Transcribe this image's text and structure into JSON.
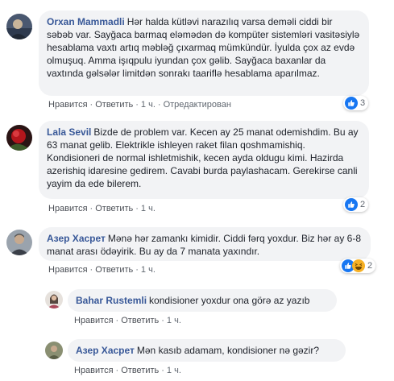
{
  "comments": [
    {
      "author": "Orxan Mammadli",
      "text": "Hər halda kütləvi narazılıq varsa deməli ciddi bir səbəb var. Sayğaca barmaq eləmədən də kompüter sistemləri vasitəsiylə hesablama vaxtı artıq məbləğ çıxarmaq mümkündür. İyulda çox az evdə olmuşuq. Amma işıqpulu iyundan çox gəlib. Sayğaca baxanlar da vaxtında gəlsələr limitdən sonrakı taariflə hesablama aparılmaz.",
      "like": "Нравится",
      "reply": "Ответить",
      "time": "1 ч.",
      "edited": "Отредактирован",
      "reactions": "3"
    },
    {
      "author": "Lala Sevil",
      "text": "Bizde de problem var. Kecen ay 25 manat odemishdim. Bu ay 63 manat gelib. Elektrikle ishleyen raket filan qoshmamishiq. Kondisioneri de normal ishletmishik, kecen ayda oldugu kimi. Hazirda azerishiq idaresine gedirem. Cavabi burda paylashacam. Gerekirse canli yayim da ede bilerem.",
      "like": "Нравится",
      "reply": "Ответить",
      "time": "1 ч.",
      "reactions": "2"
    },
    {
      "author": "Азер Хасрет",
      "text": "Mənə hər zamankı kimidir. Ciddi fərq yoxdur. Biz hər ay 6-8 manat arası ödəyirik. Bu ay da 7 manata yaxındır.",
      "like": "Нравится",
      "reply": "Ответить",
      "time": "1 ч.",
      "reactions": "2"
    }
  ],
  "replies": [
    {
      "author": "Bahar Rustemli",
      "text": "kondisioner yoxdur ona görə az yazıb",
      "like": "Нравится",
      "reply": "Ответить",
      "time": "1 ч."
    },
    {
      "author": "Азер Хасрет",
      "text": "Mən kasıb adamam, kondisioner nə gəzir?",
      "like": "Нравится",
      "reply": "Ответить",
      "time": "1 ч."
    }
  ],
  "colors": {
    "link": "#385898",
    "bubble": "#f2f3f5",
    "like_blue": "#1877f2",
    "haha_yellow": "#f7b125"
  },
  "icons": [
    "like-icon",
    "haha-icon"
  ]
}
